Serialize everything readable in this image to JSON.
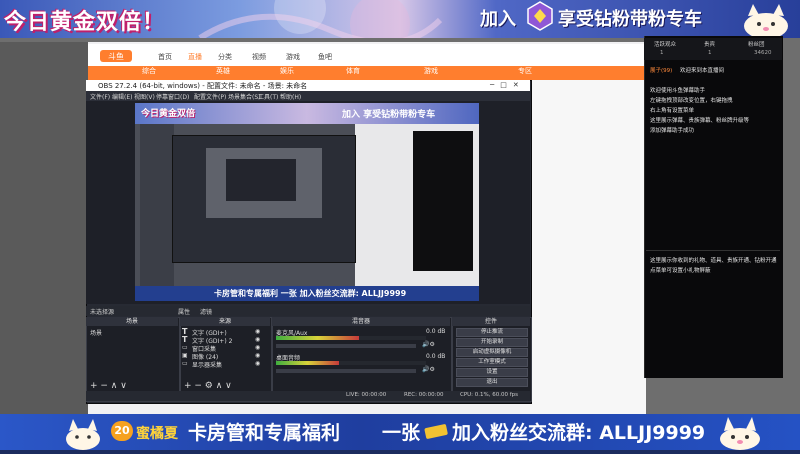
{
  "overlay_top": {
    "promo": "今日黄金双倍！",
    "join": "加入",
    "enjoy": "享受钻粉带粉专车"
  },
  "overlay_bottom": {
    "level": "20",
    "username": "蜜橘夏",
    "perk": "卡房管和专属福利",
    "ticket_prefix": "一张",
    "join_group": "加入粉丝交流群: ALLJJ9999"
  },
  "site": {
    "logo": "斗鱼",
    "header_items": [
      "首页",
      "直播",
      "分类",
      "视频",
      "游戏",
      "鱼吧"
    ],
    "nav_items": [
      "综合",
      "英雄",
      "娱乐",
      "体育",
      "游戏",
      "专区"
    ]
  },
  "obs": {
    "title": "OBS 27.2.4 (64-bit, windows) - 配置文件: 未命名 - 场景: 未命名",
    "menu": [
      "文件(F)",
      "编辑(E)",
      "视图(V)",
      "停靠窗口(D)",
      "配置文件(P)",
      "场景集合(S)",
      "工具(T)",
      "帮助(H)"
    ],
    "source_bar_label": "未选择源",
    "source_bar_props": "属性",
    "source_bar_filters": "滤镜",
    "docks": {
      "scenes_title": "场景",
      "sources_title": "来源",
      "mixer_title": "混音器",
      "controls_title": "控件"
    },
    "scenes": [
      "场景"
    ],
    "sources": [
      "文字 (GDI+)",
      "文字 (GDI+) 2",
      "窗口采集",
      "图像 (24)",
      "显示器采集"
    ],
    "mixer_tracks": [
      {
        "name": "麦克风/Aux",
        "db": "0.0 dB",
        "level": 0.55
      },
      {
        "name": "桌面音频",
        "db": "0.0 dB",
        "level": 0.42
      }
    ],
    "controls": [
      "停止推流",
      "开始录制",
      "启动虚拟摄像机",
      "工作室模式",
      "设置",
      "退出"
    ],
    "status": [
      "LIVE: 00:00:00",
      "REC: 00:00:00",
      "CPU: 0.1%, 60.00 fps"
    ]
  },
  "preview": {
    "promo": "今日黄金双倍",
    "join": "加入 享受钻粉带粉专车",
    "footer": "卡房管和专属福利 一张 加入粉丝交流群: ALLJJ9999"
  },
  "chat": {
    "tabs": [
      "活跃观众",
      "贵宾",
      "粉丝团"
    ],
    "stats": [
      "1",
      "1",
      "34620"
    ],
    "welcome_user": "展子(99)",
    "welcome_text": "欢迎来到本直播间",
    "lines": [
      "欢迎使用斗鱼弹幕助手",
      "左键拖拽顶部改变位置，右键拖拽",
      "右上角有设置菜单",
      "这里展示弹幕、贵族弹幕、粉丝牌升级等",
      "添加弹幕助手成功"
    ],
    "lines2": [
      "这里展示你收到的礼物、道具、贵族开通、钻粉开通",
      "点菜单可设置小礼物屏蔽"
    ]
  }
}
